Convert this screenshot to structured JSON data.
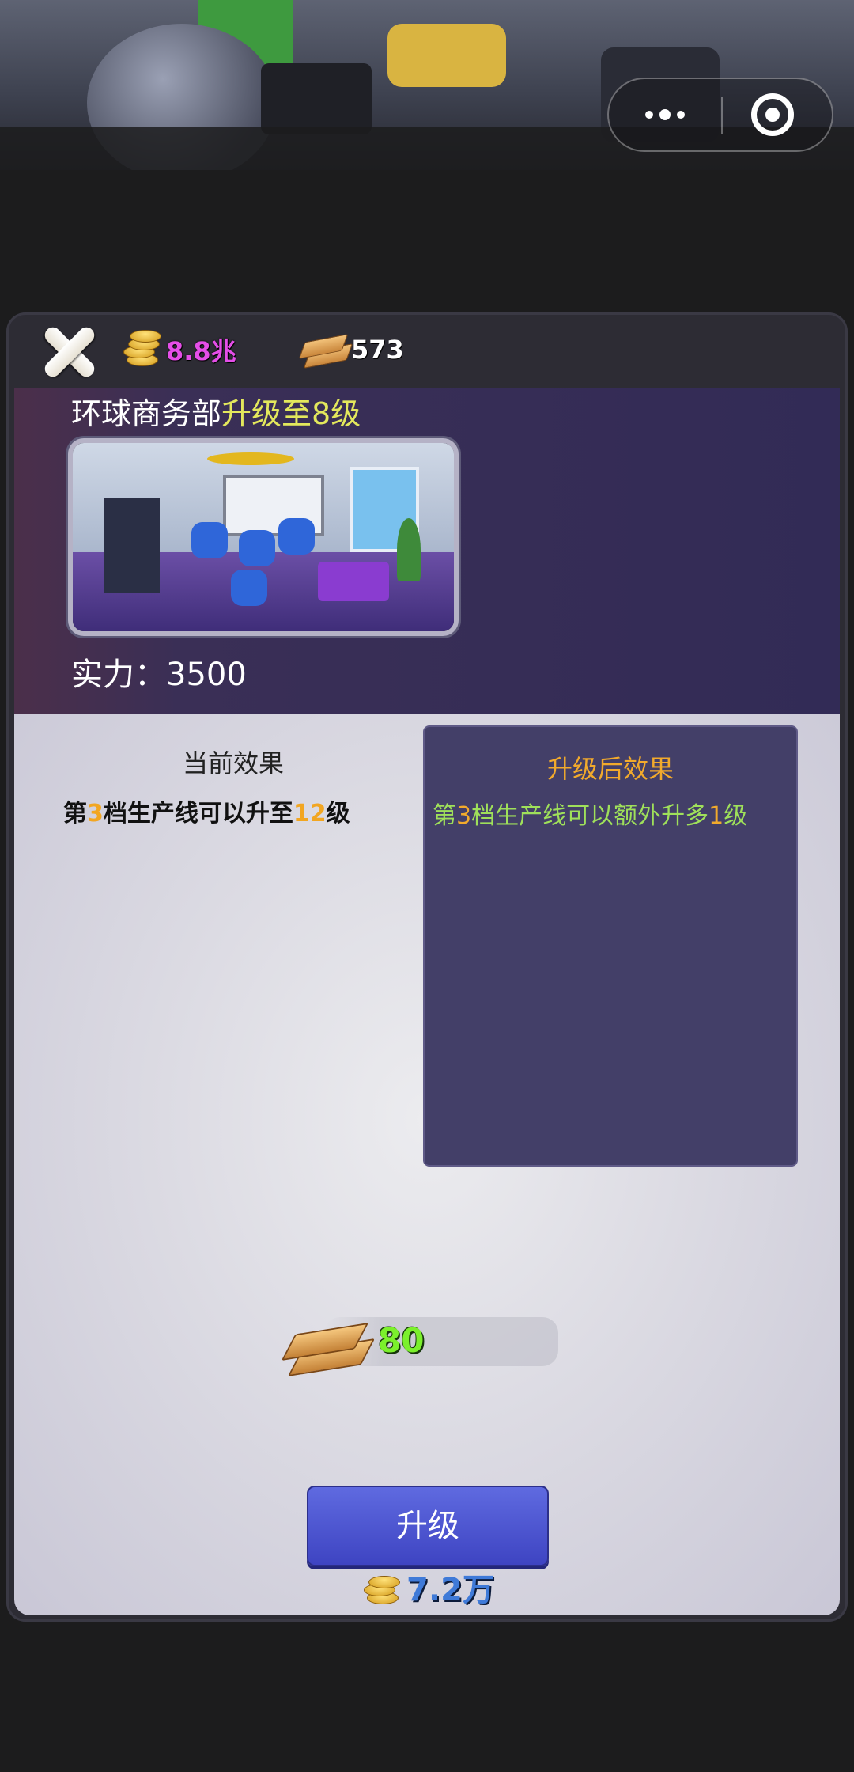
{
  "resources": {
    "gold": "8.8兆",
    "wood": "573"
  },
  "building": {
    "name": "环球商务部",
    "upgrade_text": "升级至8级",
    "power_label": "实力：",
    "power_value": "3500"
  },
  "current_effect": {
    "title": "当前效果",
    "parts": [
      "第",
      "3",
      "档生产线可以升至",
      "12",
      "级"
    ]
  },
  "after_effect": {
    "title": "升级后效果",
    "parts": [
      "第",
      "3",
      "档生产线可以额外升多",
      "1",
      "级"
    ]
  },
  "cost": {
    "wood_amount": "80",
    "gold_amount": "7.2万"
  },
  "button": {
    "upgrade_label": "升级"
  },
  "colors": {
    "gold_text": "#e54ee8",
    "highlight": "#e3e85c",
    "effect_green": "#9fe05a",
    "number_orange": "#f2aa2c",
    "button_blue": "#4f58d4"
  },
  "icons": [
    "close-icon",
    "gold-coin-icon",
    "wood-plank-icon",
    "more-icon",
    "target-icon"
  ]
}
